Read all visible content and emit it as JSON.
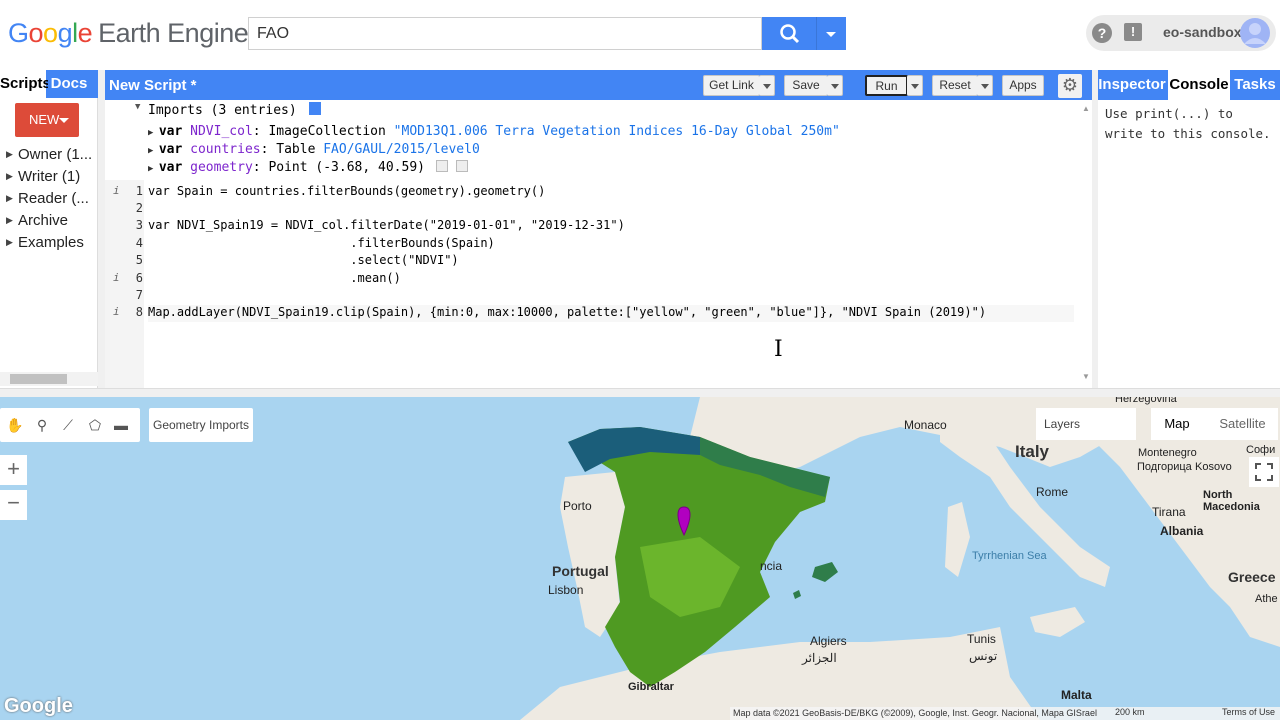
{
  "header": {
    "logo_google": "Google",
    "logo_product": "Earth Engine",
    "search_value": "FAO",
    "account": "eo-sandbox",
    "icons": [
      "search-icon",
      "chevron-down-icon",
      "help-icon",
      "feedback-icon",
      "avatar-icon"
    ]
  },
  "left_panel": {
    "tabs": [
      "Scripts",
      "Docs"
    ],
    "new_label": "NEW",
    "items": [
      "Owner (1...",
      "Writer (1)",
      "Reader (...",
      "Archive",
      "Examples"
    ]
  },
  "editor": {
    "title": "New Script *",
    "buttons": {
      "get_link": "Get Link",
      "save": "Save",
      "run": "Run",
      "reset": "Reset",
      "apps": "Apps"
    },
    "imports_header": "Imports (3 entries)",
    "imports": [
      {
        "kw": "var",
        "name": "NDVI_col",
        "sep": ": ",
        "type": "ImageCollection ",
        "value": "\"MOD13Q1.006 Terra Vegetation Indices 16-Day Global 250m\""
      },
      {
        "kw": "var",
        "name": "countries",
        "sep": ": ",
        "type": "Table ",
        "value": "FAO/GAUL/2015/level0"
      },
      {
        "kw": "var",
        "name": "geometry",
        "sep": ": ",
        "type": "Point (-3.68, 40.59)",
        "value": ""
      }
    ],
    "line_numbers": [
      "1",
      "2",
      "3",
      "4",
      "5",
      "6",
      "7",
      "8"
    ],
    "lines": [
      "var Spain = countries.filterBounds(geometry).geometry()",
      "",
      "var NDVI_Spain19 = NDVI_col.filterDate(\"2019-01-01\", \"2019-12-31\")",
      "                            .filterBounds(Spain)",
      "                            .select(\"NDVI\")",
      "                            .mean()",
      "",
      "Map.addLayer(NDVI_Spain19.clip(Spain), {min:0, max:10000, palette:[\"yellow\", \"green\", \"blue\"]}, \"NDVI Spain (2019)\")"
    ]
  },
  "right_panel": {
    "tabs": [
      "Inspector",
      "Console",
      "Tasks"
    ],
    "console_text": "Use print(...) to write to this console."
  },
  "map": {
    "geometry_imports": "Geometry Imports",
    "layers": "Layers",
    "map_type": [
      "Map",
      "Satellite"
    ],
    "zoom_in": "+",
    "zoom_out": "−",
    "labels": {
      "porto": "Porto",
      "portugal": "Portugal",
      "lisbon": "Lisbon",
      "monaco": "Monaco",
      "italy": "Italy",
      "rome": "Rome",
      "tirana": "Tirana",
      "albania": "Albania",
      "greece": "Greece",
      "kosovo": "Kosovo",
      "montenegro": "Montenegro",
      "podgorica": "Подгорица",
      "north_macedonia": "North Macedonia",
      "sofia": "Софи",
      "athens": "Athe",
      "herzegovina": "Herzegovina",
      "tyrrhenian": "Tyrrhenian Sea",
      "algiers": "Algiers",
      "algiers_ar": "الجزائر",
      "tunis": "Tunis",
      "tunis_ar": "تونس",
      "malta": "Malta",
      "gibraltar": "Gibraltar",
      "valencia": "ncia",
      "satellite": "Satellite"
    },
    "google": "Google",
    "attribution": "Map data ©2021 GeoBasis-DE/BKG (©2009), Google, Inst. Geogr. Nacional, Mapa GISrael",
    "scale": "200 km",
    "terms": "Terms of Use"
  }
}
